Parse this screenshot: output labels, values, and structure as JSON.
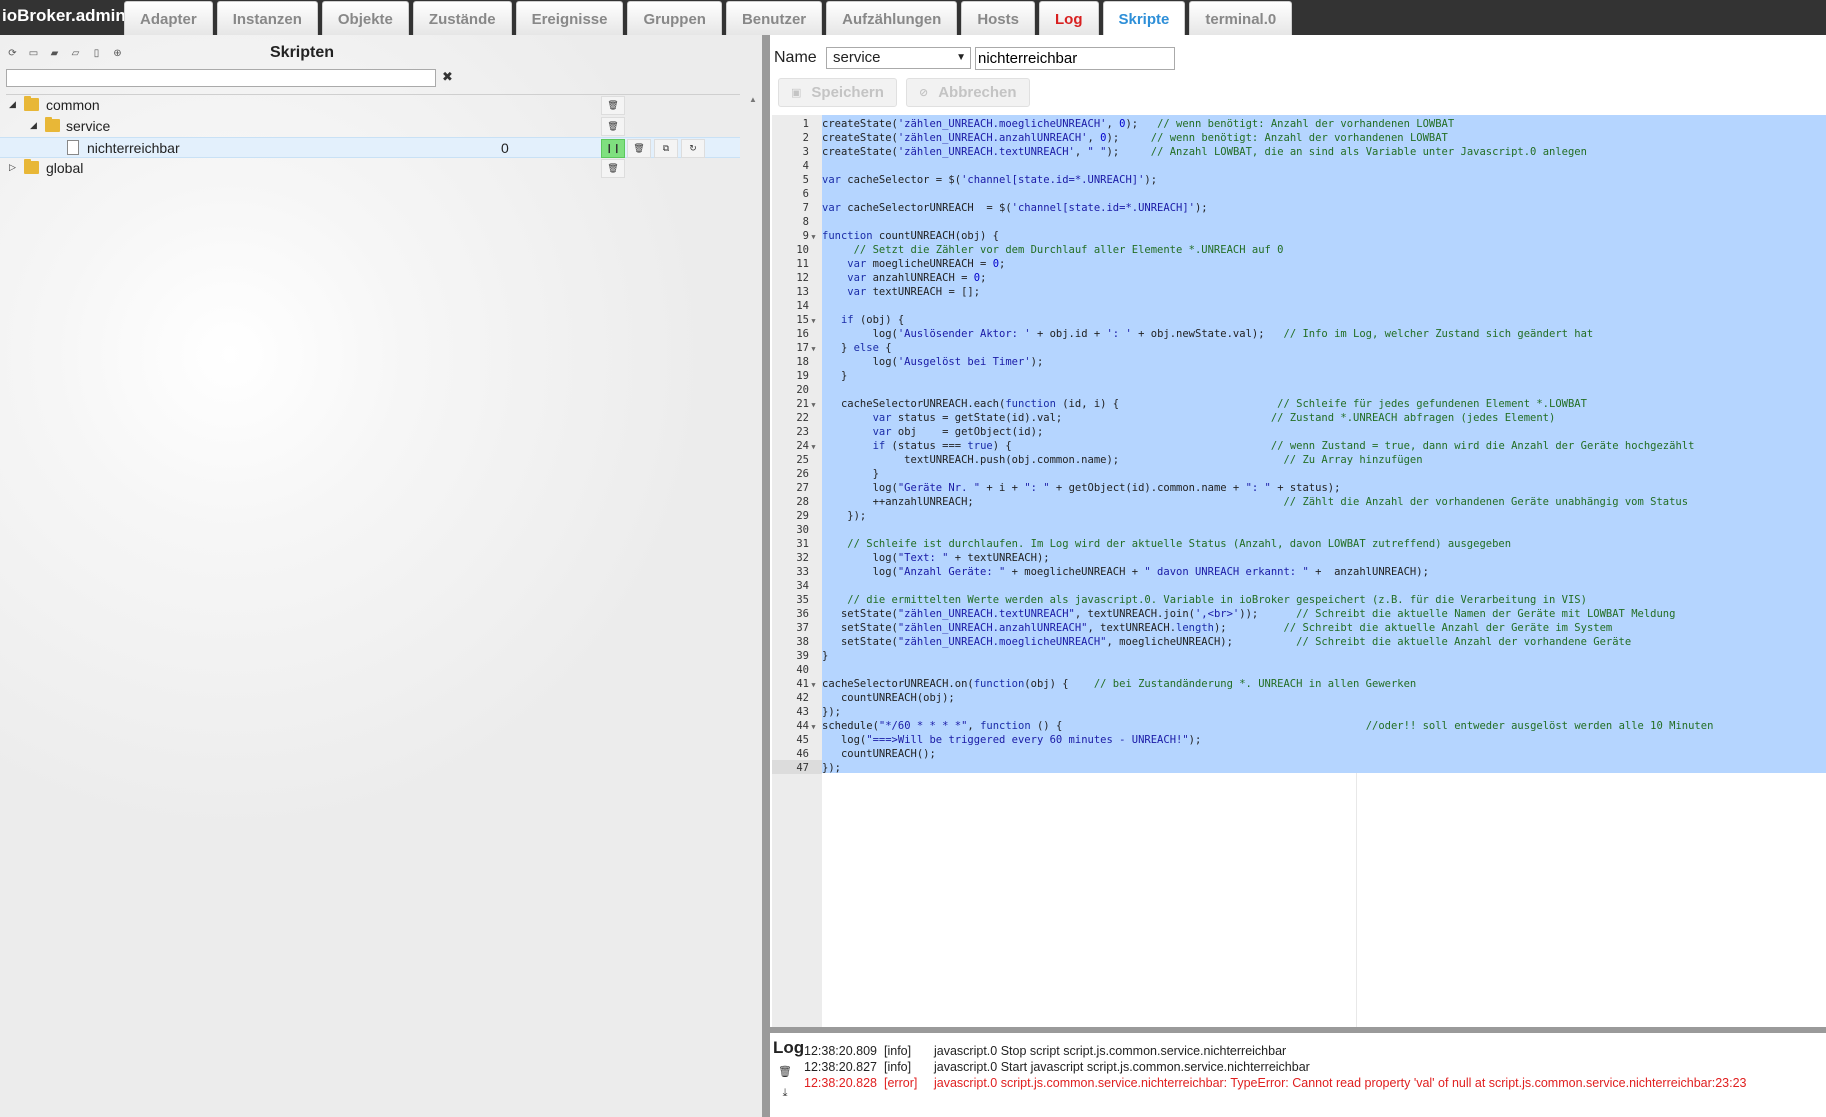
{
  "app": {
    "title": "ioBroker.admin"
  },
  "tabs": [
    {
      "label": "Adapter",
      "state": "normal"
    },
    {
      "label": "Instanzen",
      "state": "normal"
    },
    {
      "label": "Objekte",
      "state": "normal"
    },
    {
      "label": "Zustände",
      "state": "normal"
    },
    {
      "label": "Ereignisse",
      "state": "normal"
    },
    {
      "label": "Gruppen",
      "state": "normal"
    },
    {
      "label": "Benutzer",
      "state": "normal"
    },
    {
      "label": "Aufzählungen",
      "state": "normal"
    },
    {
      "label": "Hosts",
      "state": "normal"
    },
    {
      "label": "Log",
      "state": "log"
    },
    {
      "label": "Skripte",
      "state": "active"
    },
    {
      "label": "terminal.0",
      "state": "normal"
    }
  ],
  "scripts_panel": {
    "title": "Skripten",
    "filter": {
      "value": "",
      "placeholder": ""
    },
    "clear_glyph": "✖",
    "tree": {
      "common": {
        "label": "common"
      },
      "service": {
        "label": "service"
      },
      "script": {
        "label": "nichterreichbar",
        "count": "0"
      },
      "global": {
        "label": "global"
      }
    }
  },
  "editor_panel": {
    "name_label": "Name",
    "folder_select": "service",
    "name_value": "nichterreichbar",
    "save_label": "Speichern",
    "cancel_label": "Abbrechen"
  },
  "code_lines": [
    {
      "fold": false,
      "html": "createState(<span class=\"s\">'zählen_UNREACH.moeglicheUNREACH'</span>, <span class=\"n\">0</span>);   <span class=\"c\">// wenn benötigt: Anzahl der vorhandenen LOWBAT</span>"
    },
    {
      "fold": false,
      "html": "createState(<span class=\"s\">'zählen_UNREACH.anzahlUNREACH'</span>, <span class=\"n\">0</span>);     <span class=\"c\">// wenn benötigt: Anzahl der vorhandenen LOWBAT</span>"
    },
    {
      "fold": false,
      "html": "createState(<span class=\"s\">'zählen_UNREACH.textUNREACH'</span>, <span class=\"s\">\" \"</span>);     <span class=\"c\">// Anzahl LOWBAT, die an sind als Variable unter Javascript.0 anlegen</span>"
    },
    {
      "fold": false,
      "html": ""
    },
    {
      "fold": false,
      "html": "<span class=\"k\">var</span> cacheSelector = $(<span class=\"s\">'channel[state.id=*.UNREACH]'</span>);"
    },
    {
      "fold": false,
      "html": ""
    },
    {
      "fold": false,
      "html": "<span class=\"k\">var</span> cacheSelectorUNREACH  = $(<span class=\"s\">'channel[state.id=*.UNREACH]'</span>);"
    },
    {
      "fold": false,
      "html": ""
    },
    {
      "fold": true,
      "html": "<span class=\"k\">function</span> countUNREACH(obj) {"
    },
    {
      "fold": false,
      "html": "     <span class=\"c\">// Setzt die Zähler vor dem Durchlauf aller Elemente *.UNREACH auf 0</span>"
    },
    {
      "fold": false,
      "html": "    <span class=\"k\">var</span> moeglicheUNREACH = <span class=\"n\">0</span>;"
    },
    {
      "fold": false,
      "html": "    <span class=\"k\">var</span> anzahlUNREACH = <span class=\"n\">0</span>;"
    },
    {
      "fold": false,
      "html": "    <span class=\"k\">var</span> textUNREACH = [];"
    },
    {
      "fold": false,
      "html": ""
    },
    {
      "fold": true,
      "html": "   <span class=\"k\">if</span> (obj) {"
    },
    {
      "fold": false,
      "html": "        log(<span class=\"s\">'Auslösender Aktor: '</span> + obj.id + <span class=\"s\">': '</span> + obj.newState.val);   <span class=\"c\">// Info im Log, welcher Zustand sich geändert hat</span>"
    },
    {
      "fold": true,
      "html": "   } <span class=\"k\">else</span> {"
    },
    {
      "fold": false,
      "html": "        log(<span class=\"s\">'Ausgelöst bei Timer'</span>);"
    },
    {
      "fold": false,
      "html": "   }"
    },
    {
      "fold": false,
      "html": ""
    },
    {
      "fold": true,
      "html": "   cacheSelectorUNREACH.each(<span class=\"k\">function</span> (id, i) {                         <span class=\"c\">// Schleife für jedes gefundenen Element *.LOWBAT</span>"
    },
    {
      "fold": false,
      "html": "        <span class=\"k\">var</span> status = getState(id).val;                                 <span class=\"c\">// Zustand *.UNREACH abfragen (jedes Element)</span>"
    },
    {
      "fold": false,
      "html": "        <span class=\"k\">var</span> obj    = getObject(id);"
    },
    {
      "fold": true,
      "html": "        <span class=\"k\">if</span> (status === <span class=\"k\">true</span>) {                                         <span class=\"c\">// wenn Zustand = true, dann wird die Anzahl der Geräte hochgezählt</span>"
    },
    {
      "fold": false,
      "html": "             textUNREACH.push(obj.common.name);                          <span class=\"c\">// Zu Array hinzufügen</span>"
    },
    {
      "fold": false,
      "html": "        }"
    },
    {
      "fold": false,
      "html": "        log(<span class=\"s\">\"Geräte Nr. \"</span> + i + <span class=\"s\">\": \"</span> + getObject(id).common.name + <span class=\"s\">\": \"</span> + status);"
    },
    {
      "fold": false,
      "html": "        ++anzahlUNREACH;                                                 <span class=\"c\">// Zählt die Anzahl der vorhandenen Geräte unabhängig vom Status</span>"
    },
    {
      "fold": false,
      "html": "    });"
    },
    {
      "fold": false,
      "html": ""
    },
    {
      "fold": false,
      "html": "    <span class=\"c\">// Schleife ist durchlaufen. Im Log wird der aktuelle Status (Anzahl, davon LOWBAT zutreffend) ausgegeben</span>"
    },
    {
      "fold": false,
      "html": "        log(<span class=\"s\">\"Text: \"</span> + textUNREACH);"
    },
    {
      "fold": false,
      "html": "        log(<span class=\"s\">\"Anzahl Geräte: \"</span> + moeglicheUNREACH + <span class=\"s\">\" davon UNREACH erkannt: \"</span> +  anzahlUNREACH);"
    },
    {
      "fold": false,
      "html": ""
    },
    {
      "fold": false,
      "html": "    <span class=\"c\">// die ermittelten Werte werden als javascript.0. Variable in ioBroker gespeichert (z.B. für die Verarbeitung in VIS)</span>"
    },
    {
      "fold": false,
      "html": "   setState(<span class=\"s\">\"zählen_UNREACH.textUNREACH\"</span>, textUNREACH.join(<span class=\"s\">',&lt;br&gt;'</span>));      <span class=\"c\">// Schreibt die aktuelle Namen der Geräte mit LOWBAT Meldung</span>"
    },
    {
      "fold": false,
      "html": "   setState(<span class=\"s\">\"zählen_UNREACH.anzahlUNREACH\"</span>, textUNREACH.<span class=\"k\">length</span>);         <span class=\"c\">// Schreibt die aktuelle Anzahl der Geräte im System</span>"
    },
    {
      "fold": false,
      "html": "   setState(<span class=\"s\">\"zählen_UNREACH.moeglicheUNREACH\"</span>, moeglicheUNREACH);          <span class=\"c\">// Schreibt die aktuelle Anzahl der vorhandene Geräte</span>"
    },
    {
      "fold": false,
      "html": "}"
    },
    {
      "fold": false,
      "html": ""
    },
    {
      "fold": true,
      "html": "cacheSelectorUNREACH.on(<span class=\"k\">function</span>(obj) {    <span class=\"c\">// bei Zustandänderung *. UNREACH in allen Gewerken</span>"
    },
    {
      "fold": false,
      "html": "   countUNREACH(obj);"
    },
    {
      "fold": false,
      "html": "});"
    },
    {
      "fold": true,
      "html": "schedule(<span class=\"s\">\"*/60 * * * *\"</span>, <span class=\"k\">function</span> () {                                                <span class=\"c\">//oder!! soll entweder ausgelöst werden alle 10 Minuten</span>"
    },
    {
      "fold": false,
      "html": "   log(<span class=\"s\">\"===&gt;Will be triggered every 60 minutes - UNREACH!\"</span>);"
    },
    {
      "fold": false,
      "html": "   countUNREACH();"
    },
    {
      "fold": false,
      "html": "});"
    }
  ],
  "log": {
    "title": "Log",
    "lines": [
      {
        "time": "12:38:20.809",
        "level": "[info]",
        "message": "javascript.0 Stop script script.js.common.service.nichterreichbar",
        "error": false
      },
      {
        "time": "12:38:20.827",
        "level": "[info]",
        "message": "javascript.0 Start javascript script.js.common.service.nichterreichbar",
        "error": false
      },
      {
        "time": "12:38:20.828",
        "level": "[error]",
        "message": "javascript.0 script.js.common.service.nichterreichbar: TypeError: Cannot read property 'val' of null at script.js.common.service.nichterreichbar:23:23",
        "error": true
      }
    ]
  },
  "colors": {
    "accent": "#2e8fd8",
    "log_tab": "#d82020",
    "selection": "#b5d5ff",
    "error": "#e02020"
  }
}
